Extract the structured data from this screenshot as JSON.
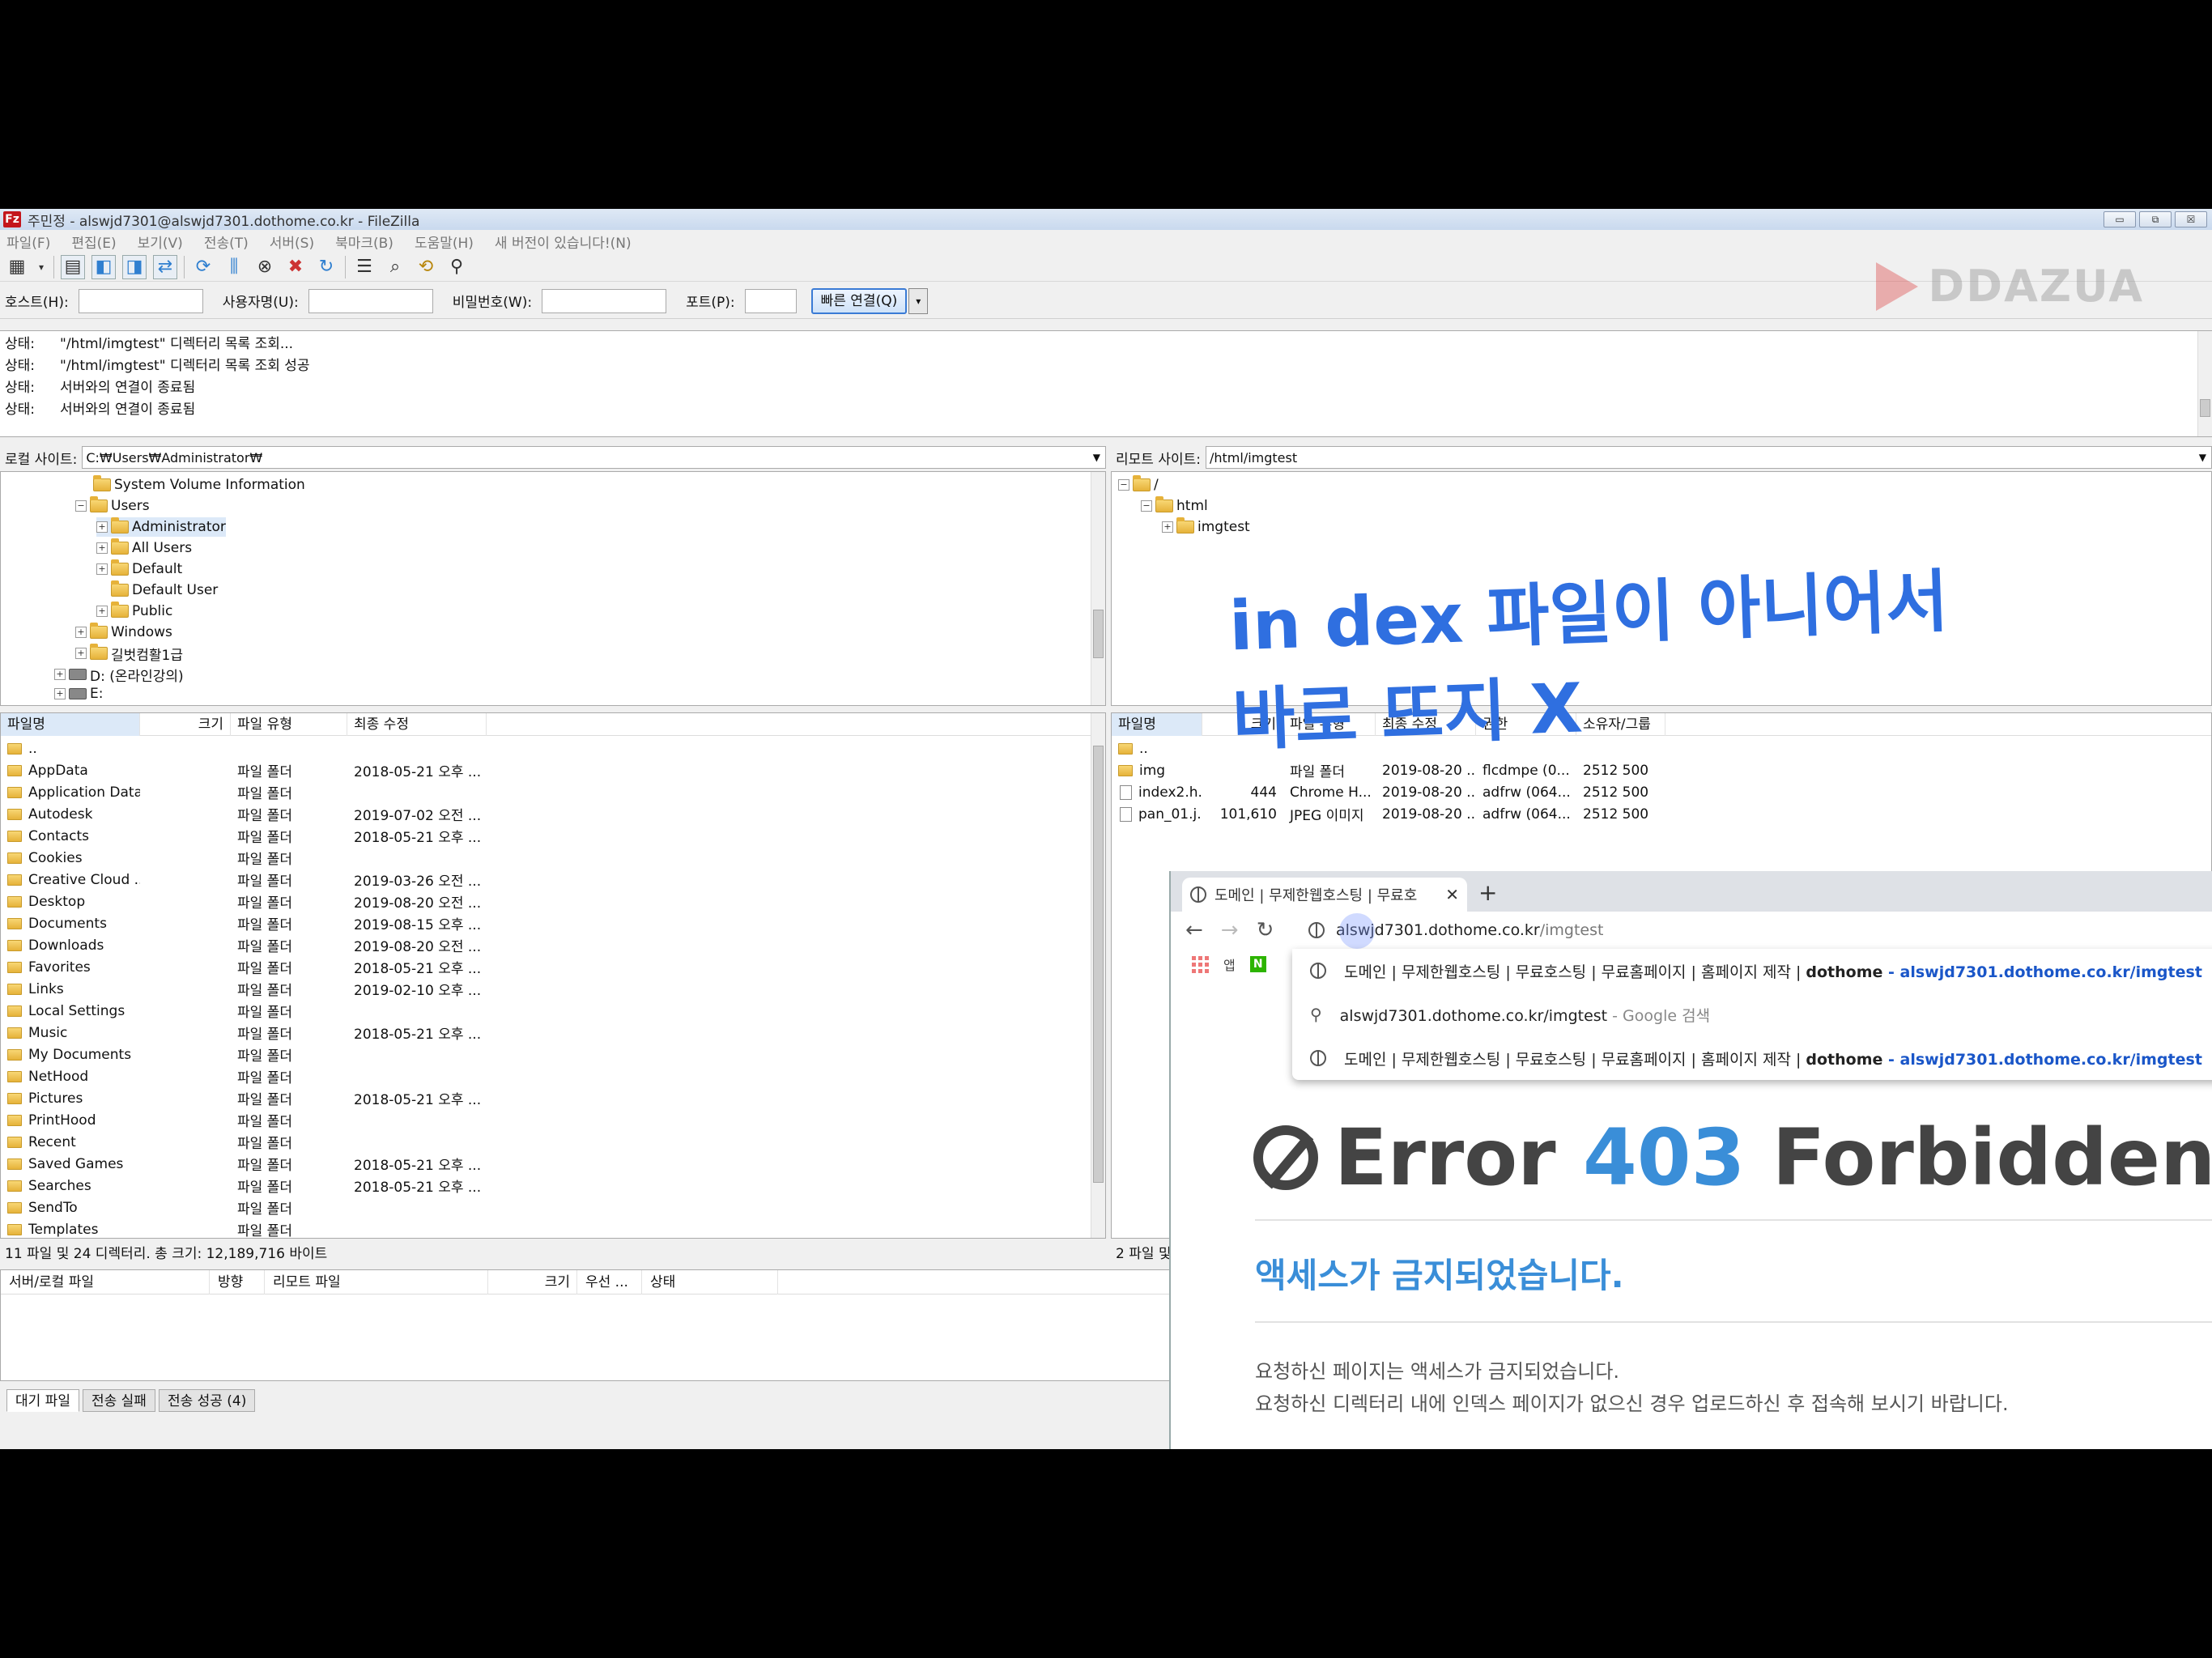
{
  "window": {
    "title": "주민정 - alswjd7301@alswjd7301.dothome.co.kr - FileZilla",
    "btn_min": "▭",
    "btn_max": "⧉",
    "btn_close": "☒"
  },
  "menu": [
    "파일(F)",
    "편집(E)",
    "보기(V)",
    "전송(T)",
    "서버(S)",
    "북마크(B)",
    "도움말(H)",
    "새 버전이 있습니다!(N)"
  ],
  "quickconnect": {
    "host_label": "호스트(H):",
    "user_label": "사용자명(U):",
    "pass_label": "비밀번호(W):",
    "port_label": "포트(P):",
    "connect_btn": "빠른 연결(Q)"
  },
  "watermark": "DDAZUA",
  "log": [
    {
      "k": "상태:",
      "v": "\"/html/imgtest\" 디렉터리 목록 조회..."
    },
    {
      "k": "상태:",
      "v": "\"/html/imgtest\" 디렉터리 목록 조회 성공"
    },
    {
      "k": "상태:",
      "v": "서버와의 연결이 종료됨"
    },
    {
      "k": "상태:",
      "v": "서버와의 연결이 종료됨"
    }
  ],
  "local": {
    "label": "로컬 사이트:",
    "path": "C:₩Users₩Administrator₩",
    "tree": [
      "System Volume Information",
      "Users",
      "Administrator",
      "All Users",
      "Default",
      "Default User",
      "Public",
      "Windows",
      "길벗컴활1급",
      "D: (온라인강의)",
      "E:"
    ],
    "headers": [
      "파일명",
      "크기",
      "파일 유형",
      "최종 수정"
    ],
    "files": [
      {
        "n": "..",
        "t": "",
        "d": ""
      },
      {
        "n": "AppData",
        "t": "파일 폴더",
        "d": "2018-05-21 오후 ..."
      },
      {
        "n": "Application Data",
        "t": "파일 폴더",
        "d": ""
      },
      {
        "n": "Autodesk",
        "t": "파일 폴더",
        "d": "2019-07-02 오전 ..."
      },
      {
        "n": "Contacts",
        "t": "파일 폴더",
        "d": "2018-05-21 오후 ..."
      },
      {
        "n": "Cookies",
        "t": "파일 폴더",
        "d": ""
      },
      {
        "n": "Creative Cloud ...",
        "t": "파일 폴더",
        "d": "2019-03-26 오전 ..."
      },
      {
        "n": "Desktop",
        "t": "파일 폴더",
        "d": "2019-08-20 오전 ..."
      },
      {
        "n": "Documents",
        "t": "파일 폴더",
        "d": "2019-08-15 오후 ..."
      },
      {
        "n": "Downloads",
        "t": "파일 폴더",
        "d": "2019-08-20 오전 ..."
      },
      {
        "n": "Favorites",
        "t": "파일 폴더",
        "d": "2018-05-21 오후 ..."
      },
      {
        "n": "Links",
        "t": "파일 폴더",
        "d": "2019-02-10 오후 ..."
      },
      {
        "n": "Local Settings",
        "t": "파일 폴더",
        "d": ""
      },
      {
        "n": "Music",
        "t": "파일 폴더",
        "d": "2018-05-21 오후 ..."
      },
      {
        "n": "My Documents",
        "t": "파일 폴더",
        "d": ""
      },
      {
        "n": "NetHood",
        "t": "파일 폴더",
        "d": ""
      },
      {
        "n": "Pictures",
        "t": "파일 폴더",
        "d": "2018-05-21 오후 ..."
      },
      {
        "n": "PrintHood",
        "t": "파일 폴더",
        "d": ""
      },
      {
        "n": "Recent",
        "t": "파일 폴더",
        "d": ""
      },
      {
        "n": "Saved Games",
        "t": "파일 폴더",
        "d": "2018-05-21 오후 ..."
      },
      {
        "n": "Searches",
        "t": "파일 폴더",
        "d": "2018-05-21 오후 ..."
      },
      {
        "n": "SendTo",
        "t": "파일 폴더",
        "d": ""
      },
      {
        "n": "Templates",
        "t": "파일 폴더",
        "d": ""
      }
    ],
    "status": "11 파일 및 24 디렉터리. 총 크기: 12,189,716 바이트"
  },
  "remote": {
    "label": "리모트 사이트:",
    "path": "/html/imgtest",
    "tree": [
      "/",
      "html",
      "imgtest"
    ],
    "headers": [
      "파일명",
      "크기",
      "파일 유형",
      "최종 수정",
      "권한",
      "소유자/그룹"
    ],
    "files": [
      {
        "n": "..",
        "s": "",
        "t": "",
        "d": "",
        "p": "",
        "o": ""
      },
      {
        "n": "img",
        "s": "",
        "t": "파일 폴더",
        "d": "2019-08-20 ...",
        "p": "flcdmpe (0...",
        "o": "2512 500"
      },
      {
        "n": "index2.h...",
        "s": "444",
        "t": "Chrome H...",
        "d": "2019-08-20 ...",
        "p": "adfrw (064...",
        "o": "2512 500"
      },
      {
        "n": "pan_01.j...",
        "s": "101,610",
        "t": "JPEG 이미지",
        "d": "2019-08-20 ...",
        "p": "adfrw (064...",
        "o": "2512 500"
      }
    ],
    "status": "2 파일 및"
  },
  "queue": {
    "headers": [
      "서버/로컬 파일",
      "방향",
      "리모트 파일",
      "크기",
      "우선 ...",
      "상태"
    ],
    "tabs": [
      "대기 파일",
      "전송 실패",
      "전송 성공 (4)"
    ]
  },
  "chrome": {
    "tab_title": "도메인 | 무제한웹호스팅 | 무료호",
    "omni_host": "alswjd7301.dothome.co.kr",
    "omni_path": "/imgtest",
    "bookmarks": [
      "앱",
      "N"
    ],
    "suggestions": [
      {
        "text": "도메인 | 무제한웹호스팅 | 무료호스팅 | 무료홈페이지 | 홈페이지 제작 | ",
        "bold": "dothome",
        "url": " - alswjd7301.dothome.co.kr/imgtest"
      },
      {
        "text": "alswjd7301.dothome.co.kr/imgtest",
        "bold": "",
        "url": " - Google 검색"
      },
      {
        "text": "도메인 | 무제한웹호스팅 | 무료호스팅 | 무료홈페이지 | 홈페이지 제작 | ",
        "bold": "dothome",
        "url": " - alswjd7301.dothome.co.kr/imgtest"
      }
    ],
    "error": {
      "pre": "Error ",
      "code": "403",
      "post": " Forbidden.",
      "ko_title": "액세스가 금지되었습니다.",
      "line1": "요청하신 페이지는 액세스가 금지되었습니다.",
      "line2": "요청하신 디렉터리 내에 인덱스 페이지가 없으신 경우 업로드하신 후 접속해 보시기 바랍니다."
    }
  },
  "annotation": "in dex 파일이 아니어서\n바로 뜨지 X"
}
